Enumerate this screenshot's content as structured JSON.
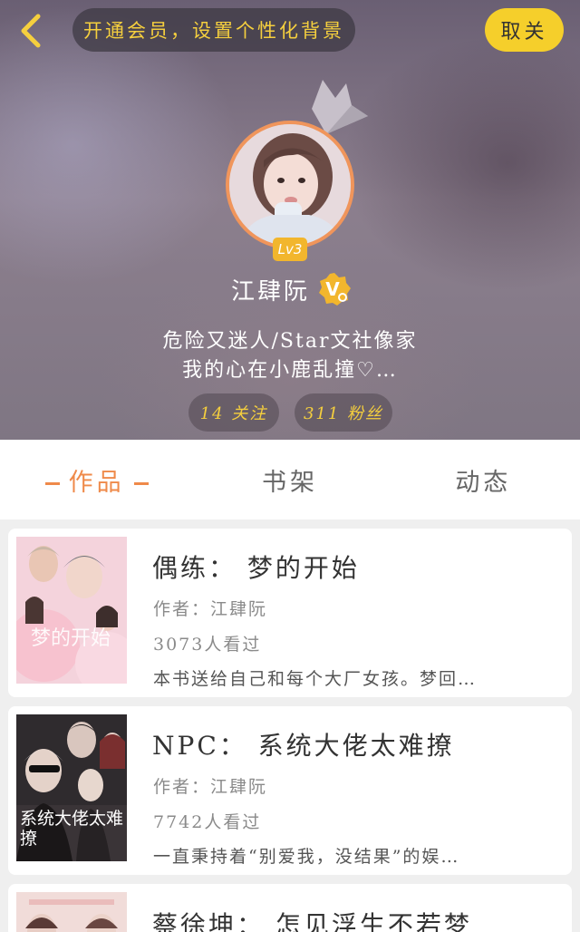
{
  "header": {
    "member_prompt": "开通会员，设置个性化背景",
    "follow_label": "取关",
    "level": "Lv3",
    "username": "江肆阮",
    "bio_line1": "危险又迷人/Star文社像家",
    "bio_line2": "我的心在小鹿乱撞♡…",
    "following": "14 关注",
    "fans": "311 粉丝"
  },
  "tabs": [
    {
      "label": "作品",
      "active": true
    },
    {
      "label": "书架",
      "active": false
    },
    {
      "label": "动态",
      "active": false
    }
  ],
  "books": [
    {
      "title": "偶练： 梦的开始",
      "author": "作者：江肆阮",
      "views": "3073人看过",
      "desc": "本书送给自己和每个大厂女孩。梦回…",
      "cover_text": "梦的开始"
    },
    {
      "title": "NPC： 系统大佬太难撩",
      "author": "作者：江肆阮",
      "views": "7742人看过",
      "desc": "一直秉持着“别爱我，没结果”的娱…",
      "cover_text": "系统大佬太难撩"
    },
    {
      "title": "蔡徐坤： 怎见浮生不若梦",
      "author": "",
      "views": "",
      "desc": "",
      "cover_text": ""
    }
  ],
  "colors": {
    "accent": "#ef8a4a",
    "gold": "#f5cf3e",
    "follow_bg": "#f5cf2b",
    "avatar_border": "#f0955b"
  }
}
